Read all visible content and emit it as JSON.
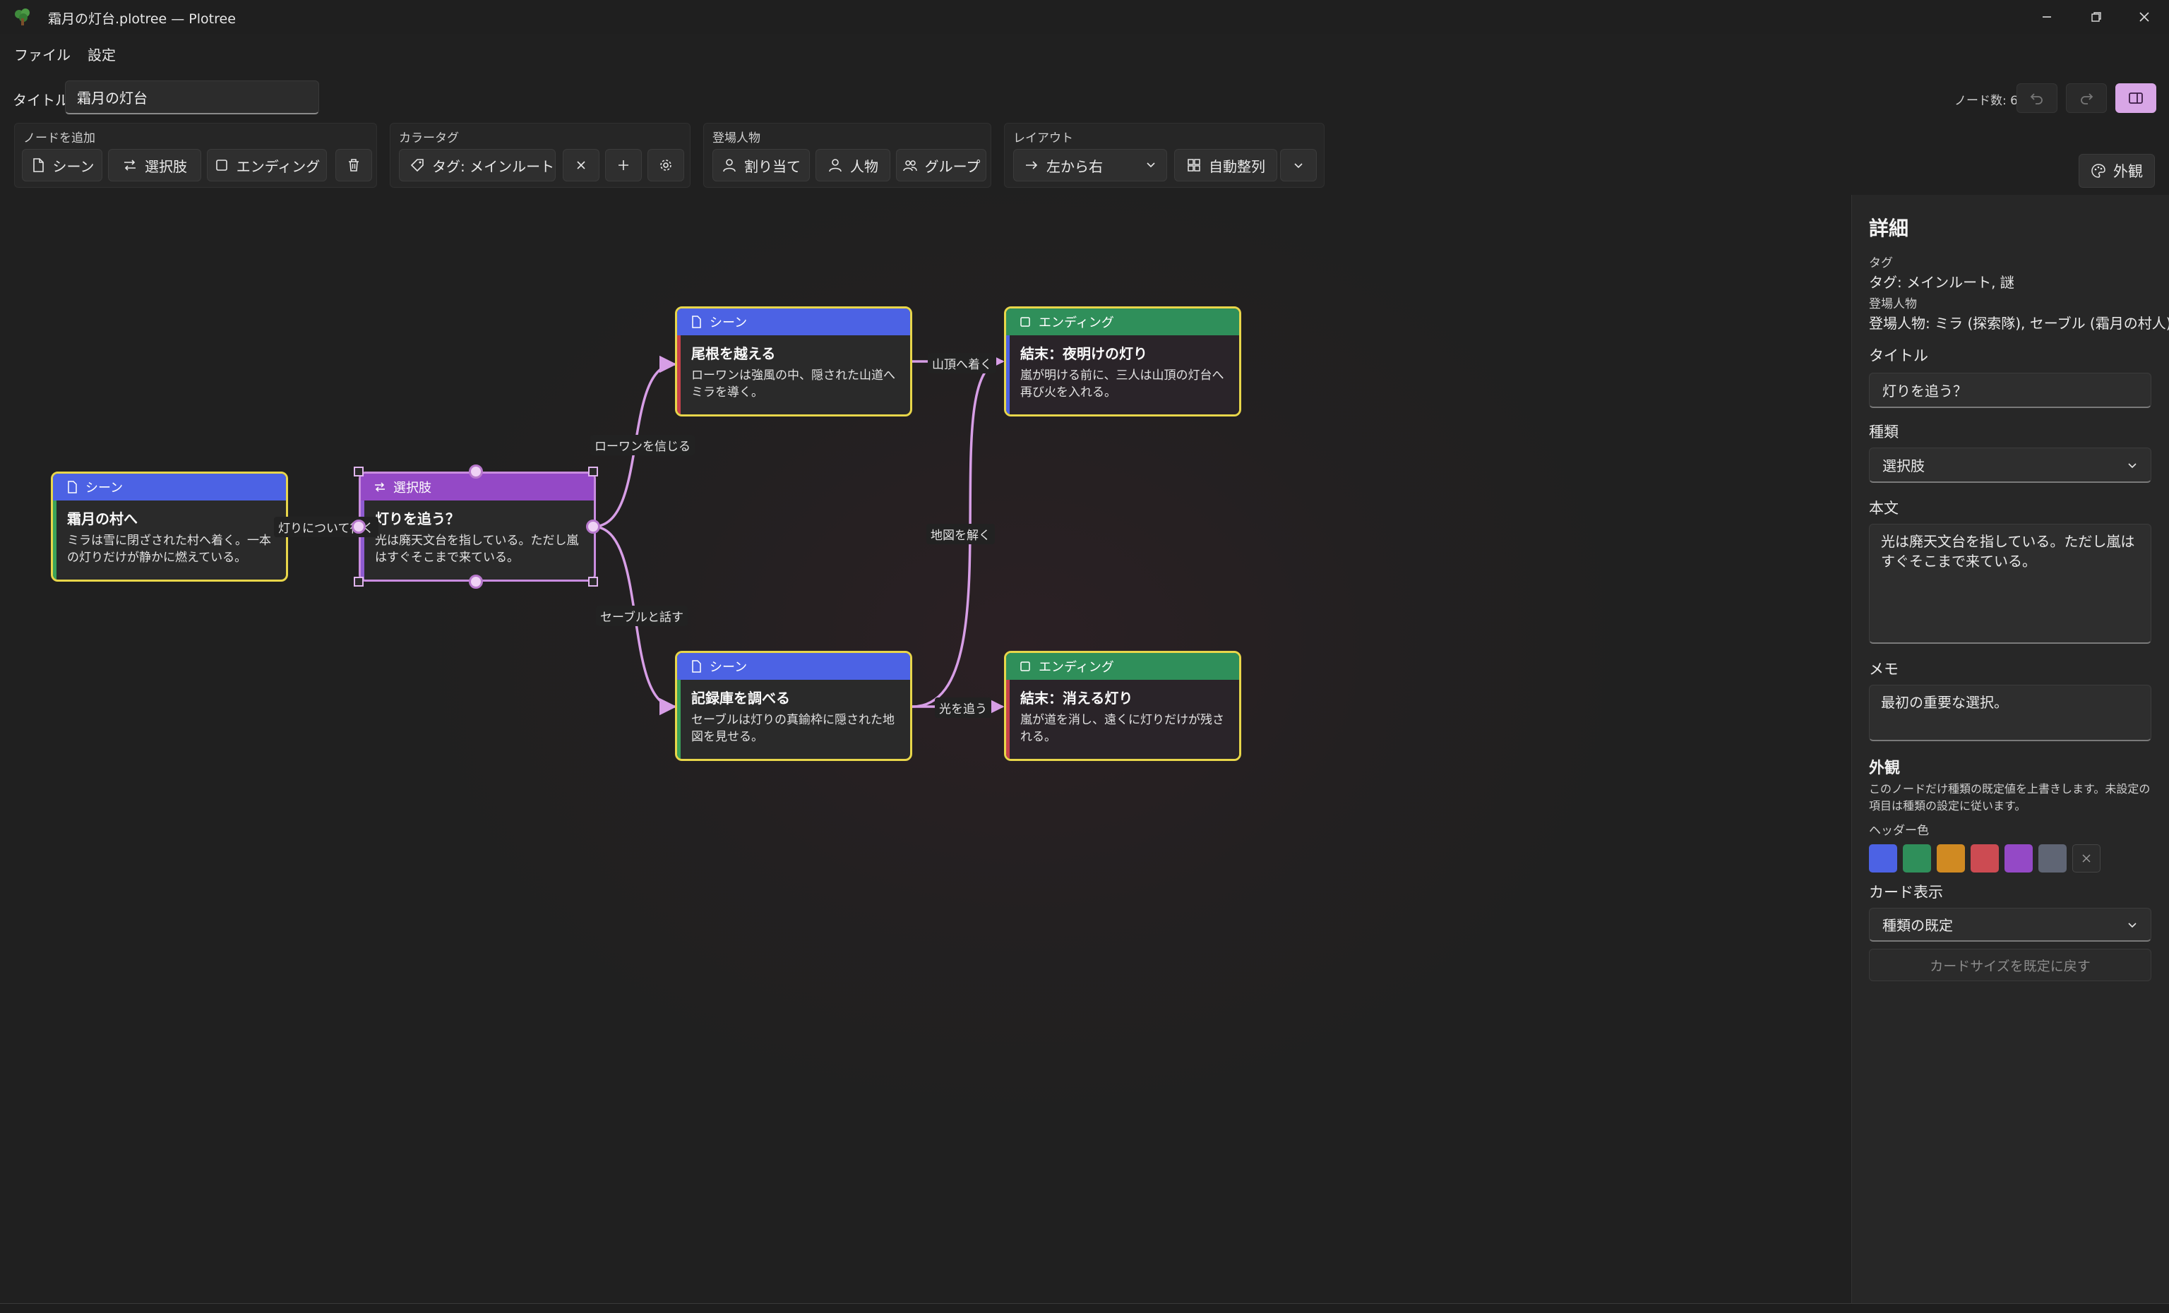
{
  "window": {
    "title": "霜月の灯台.plotree — Plotree"
  },
  "menu": {
    "file": "ファイル",
    "settings": "設定"
  },
  "title_row": {
    "label": "タイトル",
    "value": "霜月の灯台",
    "node_count": "ノード数: 6"
  },
  "toolbar": {
    "add_node": {
      "label": "ノードを追加",
      "scene": "シーン",
      "choice": "選択肢",
      "ending": "エンディング"
    },
    "color_tag": {
      "label": "カラータグ",
      "tag_value": "タグ: メインルート, 謎"
    },
    "characters": {
      "label": "登場人物",
      "assign": "割り当て",
      "person": "人物",
      "group": "グループ"
    },
    "layout": {
      "label": "レイアウト",
      "direction": "左から右",
      "auto_arrange": "自動整列"
    },
    "appearance": "外観"
  },
  "colors": {
    "scene_header": "#4c62e4",
    "choice_header": "#9449c6",
    "ending_header": "#2f8f5a",
    "highlight_border": "#e8d64a",
    "edge": "#d79ee6",
    "accent": "#d8a6e6"
  },
  "graph": {
    "nodes": {
      "village": {
        "type": "シーン",
        "title": "霜月の村へ",
        "text": "ミラは雪に閉ざされた村へ着く。一本の灯りだけが静かに燃えている。"
      },
      "choice": {
        "type": "選択肢",
        "title": "灯りを追う？",
        "text": "光は廃天文台を指している。ただし嵐はすぐそこまで来ている。"
      },
      "ridge": {
        "type": "シーン",
        "title": "尾根を越える",
        "text": "ローワンは強風の中、隠された山道へミラを導く。"
      },
      "archive": {
        "type": "シーン",
        "title": "記録庫を調べる",
        "text": "セーブルは灯りの真鍮枠に隠された地図を見せる。"
      },
      "dawn": {
        "type": "エンディング",
        "title": "結末：夜明けの灯り",
        "text": "嵐が明ける前に、三人は山頂の灯台へ再び火を入れる。"
      },
      "fade": {
        "type": "エンディング",
        "title": "結末：消える灯り",
        "text": "嵐が道を消し、遠くに灯りだけが残される。"
      }
    },
    "edges": {
      "follow_light": "灯りについて行く",
      "trust_rowan": "ローワンを信じる",
      "talk_sable": "セーブルと話す",
      "to_summit": "山頂へ着く",
      "solve_map": "地図を解く",
      "chase_light": "光を追う"
    }
  },
  "detail": {
    "heading": "詳細",
    "tag_label": "タグ",
    "tag_value": "タグ: メインルート, 謎",
    "characters_label": "登場人物",
    "characters_value": "登場人物: ミラ (探索隊), セーブル (霜月の村人)",
    "title_label": "タイトル",
    "title_value": "灯りを追う？",
    "kind_label": "種類",
    "kind_value": "選択肢",
    "body_label": "本文",
    "body_value": "光は廃天文台を指している。ただし嵐はすぐそこまで来ている。",
    "memo_label": "メモ",
    "memo_value": "最初の重要な選択。",
    "appearance_heading": "外観",
    "appearance_note": "このノードだけ種類の既定値を上書きします。未設定の項目は種類の設定に従います。",
    "header_color_label": "ヘッダー色",
    "swatches": [
      "#4c62e4",
      "#2f8f5a",
      "#d08a22",
      "#cc4b52",
      "#9449c6",
      "#5f6574"
    ],
    "card_display_label": "カード表示",
    "card_display_value": "種類の既定",
    "reset_size": "カードサイズを既定に戻す"
  }
}
